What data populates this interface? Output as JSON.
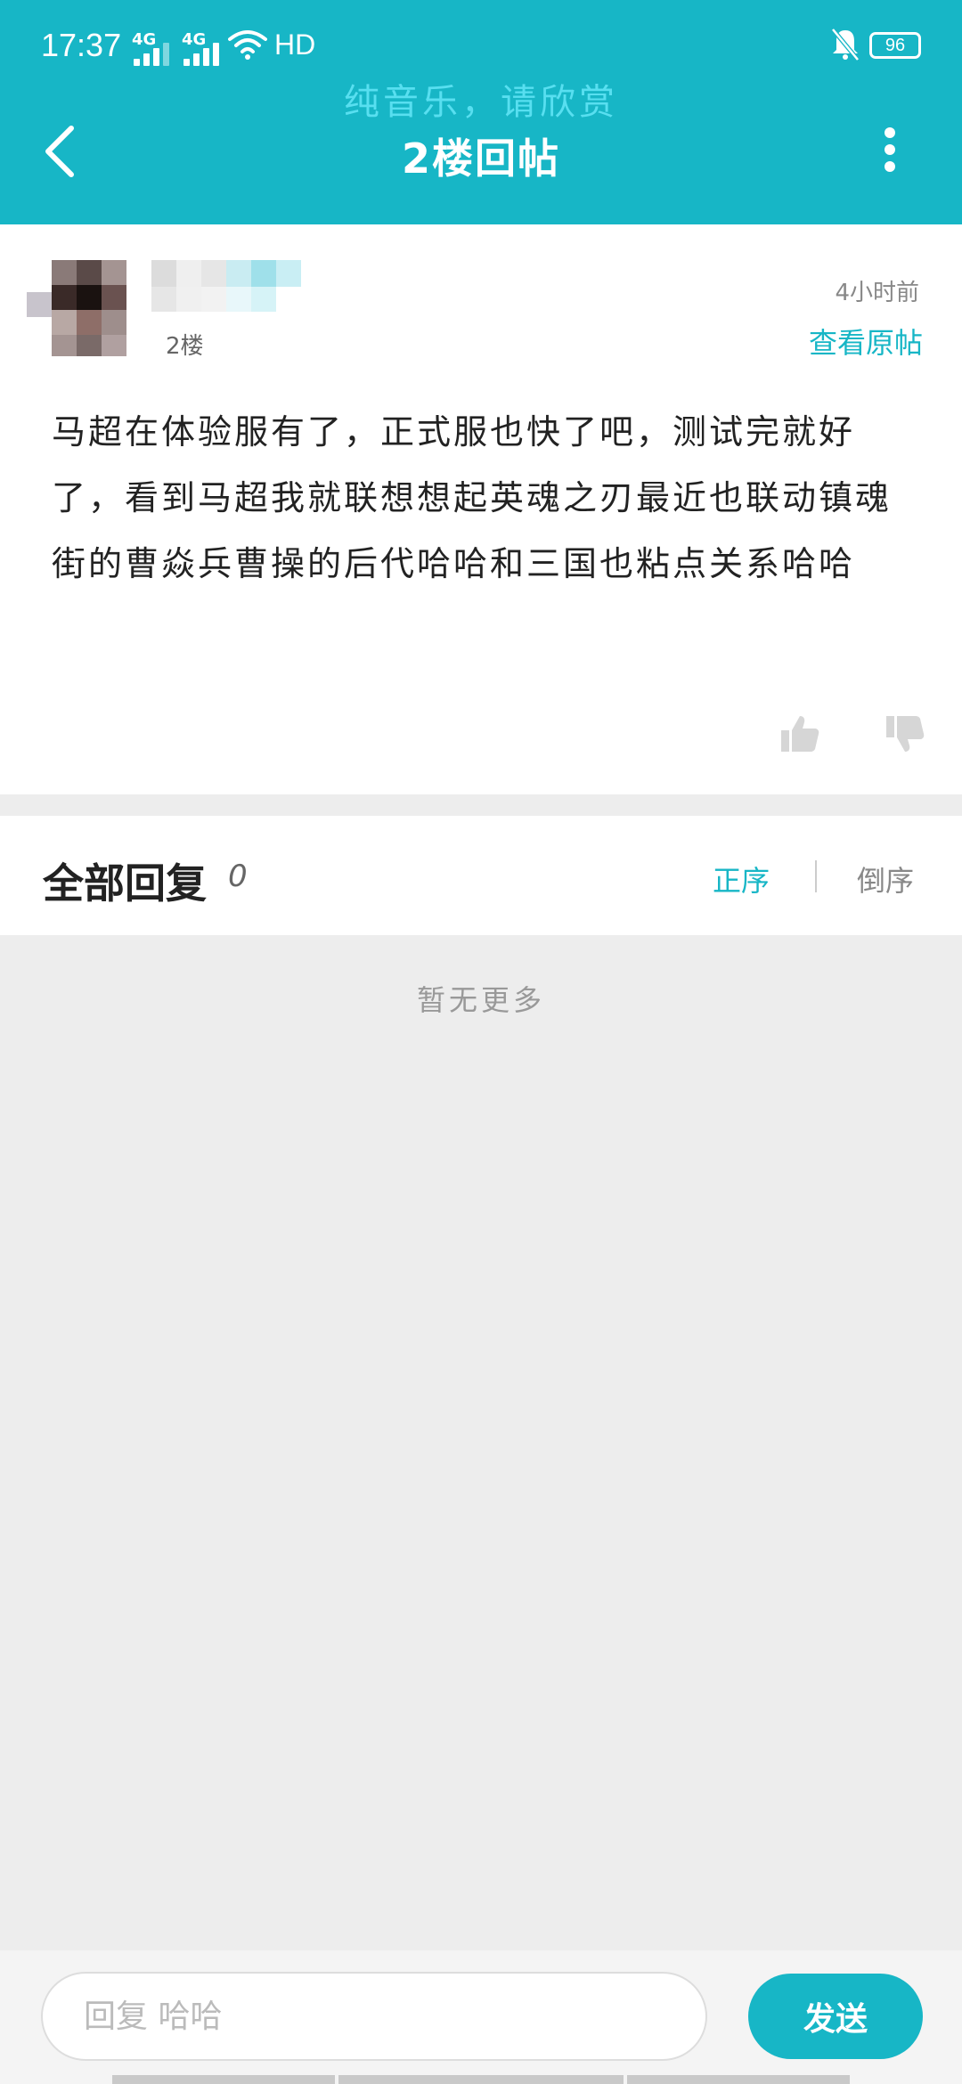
{
  "status_bar": {
    "time": "17:37",
    "network_1": "4G",
    "network_2": "4G",
    "hd": "HD",
    "battery": "96"
  },
  "header": {
    "now_playing": "纯音乐，请欣赏",
    "title": "2楼回帖"
  },
  "post": {
    "floor": "2楼",
    "time_ago": "4小时前",
    "view_original": "查看原帖",
    "content": "马超在体验服有了，正式服也快了吧，测试完就好了，看到马超我就联想想起英魂之刃最近也联动镇魂街的曹焱兵曹操的后代哈哈和三国也粘点关系哈哈"
  },
  "replies": {
    "title": "全部回复",
    "count": "0",
    "sort_asc": "正序",
    "sort_desc": "倒序",
    "empty_text": "暂无更多"
  },
  "composer": {
    "placeholder": "回复 哈哈",
    "send_label": "发送"
  },
  "colors": {
    "accent": "#17b6c6",
    "background": "#ededed"
  },
  "icons": [
    "back-arrow-icon",
    "more-vertical-icon",
    "thumbs-up-icon",
    "thumbs-down-icon",
    "wifi-icon",
    "mute-bell-icon"
  ]
}
